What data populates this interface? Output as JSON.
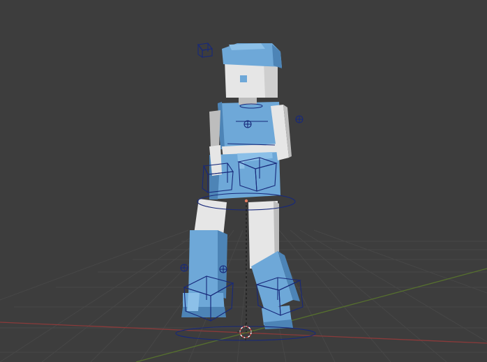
{
  "viewport": {
    "background_color": "#3d3d3d",
    "grid_color": "#474747",
    "x_axis_color": "#8a3a3a",
    "y_axis_color": "#56702e",
    "bone_control_color": "#17287a",
    "active_control_color": "#e07a5f"
  },
  "character": {
    "primary_color": "#6ea8d8",
    "primary_dark": "#4d84b6",
    "primary_light": "#8cc0e8",
    "skin_color": "#e6e6e6",
    "skin_shadow": "#bdbdbd"
  },
  "controls": {
    "icons": [
      "head-cube-control-icon",
      "hand-pole-control-icon",
      "knee-pole-control-icon",
      "root-circle-control-icon",
      "cursor-3d-icon"
    ]
  }
}
